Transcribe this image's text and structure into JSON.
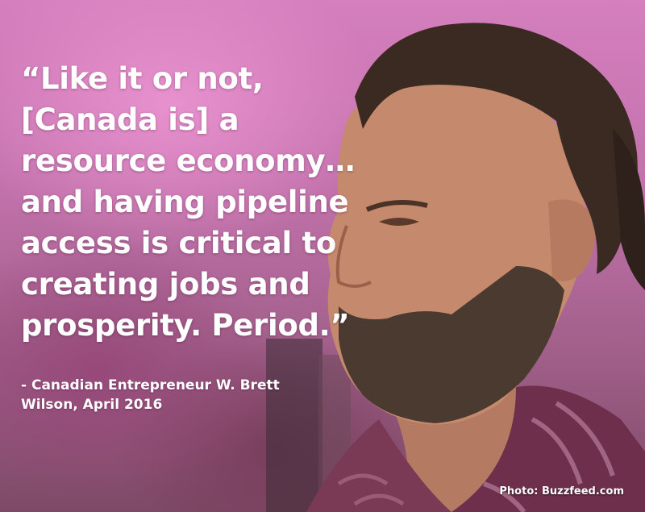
{
  "quote": {
    "text": "“Like it or not,\n[Canada is] a\nresource economy…\nand having pipeline\naccess is critical to\ncreating jobs and\nprosperity. Period.”"
  },
  "attribution": {
    "text": "- Canadian Entrepreneur W. Brett\nWilson, April 2016"
  },
  "credit": {
    "text": "Photo: Buzzfeed.com"
  },
  "colors": {
    "background": "#c372ac",
    "text": "#ffffff"
  }
}
